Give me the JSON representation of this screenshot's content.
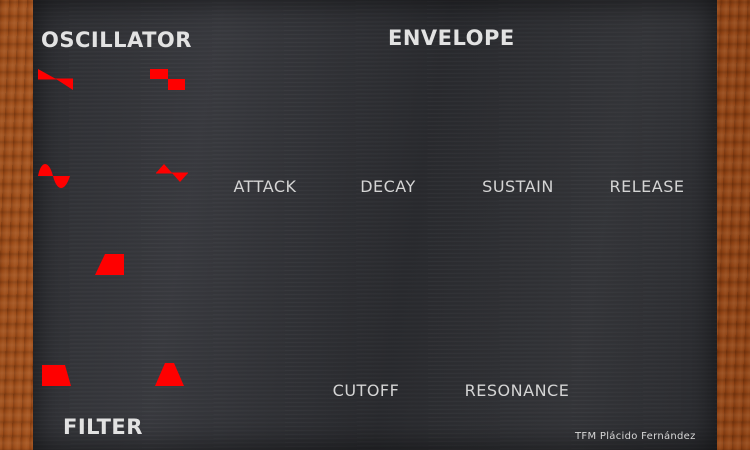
{
  "oscillator": {
    "title": "OSCILLATOR",
    "waveforms": [
      "sawtooth",
      "square",
      "sine",
      "triangle"
    ]
  },
  "envelope": {
    "title": "ENVELOPE",
    "controls": [
      "ATTACK",
      "DECAY",
      "SUSTAIN",
      "RELEASE"
    ]
  },
  "filter": {
    "title": "FILTER",
    "types": [
      "bandpass",
      "lowpass",
      "highpass"
    ],
    "controls": [
      "CUTOFF",
      "RESONANCE"
    ]
  },
  "credits": "TFM Plácido Fernández",
  "colors": {
    "panel": "#2e2f33",
    "wood": "#b35a22",
    "waveform_red": "#ff0000",
    "label_text": "#d4d4d4"
  }
}
